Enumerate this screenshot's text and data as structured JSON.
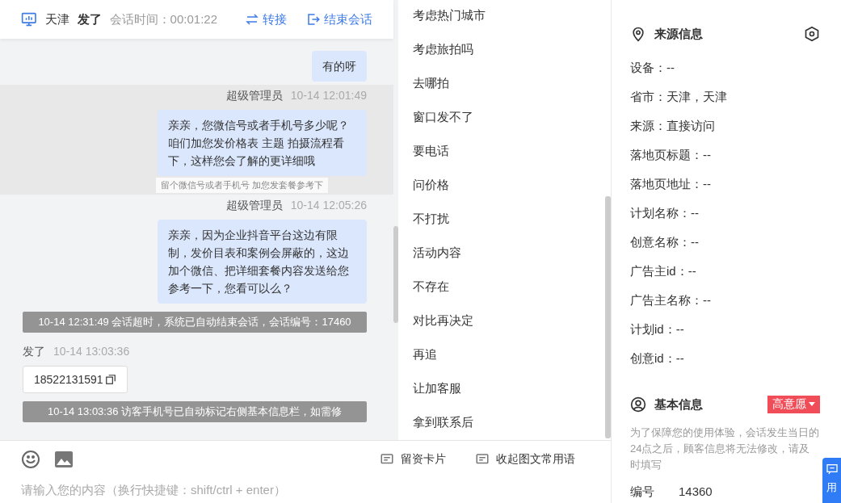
{
  "header": {
    "city": "天津",
    "visitor": "发了",
    "session_label": "会话时间：",
    "session_time": "00:01:22",
    "actions": [
      {
        "kind": "transfer",
        "label": "转接"
      },
      {
        "kind": "end",
        "label": "结束会话"
      }
    ]
  },
  "messages": [
    {
      "kind": "agent",
      "bubble": "有的呀",
      "highlighted": false
    },
    {
      "kind": "agent",
      "name": "超级管理员",
      "time": "10-14 12:01:49",
      "bubble": "亲亲，您微信号或者手机号多少呢？咱们加您发价格表 主题 拍摄流程看下，这样您会了解的更详细哦",
      "highlighted": true,
      "tooltip": "留个微信号或者手机号 加您发套餐参考下"
    },
    {
      "kind": "agent",
      "name": "超级管理员",
      "time": "10-14 12:05:26",
      "bubble": "亲亲，因为企业抖音平台这边有限制，发价目表和案例会屏蔽的，这边加个微信、把详细套餐内容发送给您参考一下，您看可以么？",
      "highlighted": false
    },
    {
      "kind": "system",
      "text": "10-14 12:31:49 会话超时，系统已自动结束会话，会话编号：17460"
    },
    {
      "kind": "visitor",
      "name": "发了",
      "time": "10-14 13:03:36",
      "bubble": "18522131591"
    },
    {
      "kind": "system",
      "text": "10-14 13:03:36 访客手机号已自动标记右侧基本信息栏，如需修"
    }
  ],
  "phrases": [
    "考虑热门城市",
    "考虑旅拍吗",
    "去哪拍",
    "窗口发不了",
    "要电话",
    "问价格",
    "不打扰",
    "活动内容",
    "不存在",
    "对比再决定",
    "再追",
    "让加客服",
    "拿到联系后"
  ],
  "composer": {
    "tools": [
      "留资卡片",
      "收起图文常用语"
    ],
    "placeholder": "请输入您的内容（换行快捷键：shift/ctrl + enter）"
  },
  "source_info": {
    "title": "来源信息",
    "rows": [
      "设备：--",
      "省市：天津，天津",
      "来源：直接访问",
      "落地页标题：--",
      "落地页地址：--",
      "计划名称：--",
      "创意名称：--",
      "广告主id：--",
      "广告主名称：--",
      "计划id：--",
      "创意id：--"
    ]
  },
  "basic_info": {
    "title": "基本信息",
    "intent": "高意愿",
    "notice": "为了保障您的使用体验，会话发生当日的24点之后，顾客信息将无法修改，请及时填写",
    "fields": [
      {
        "label": "编号",
        "value": "14360"
      }
    ]
  },
  "floating_tab": {
    "label": "用"
  }
}
